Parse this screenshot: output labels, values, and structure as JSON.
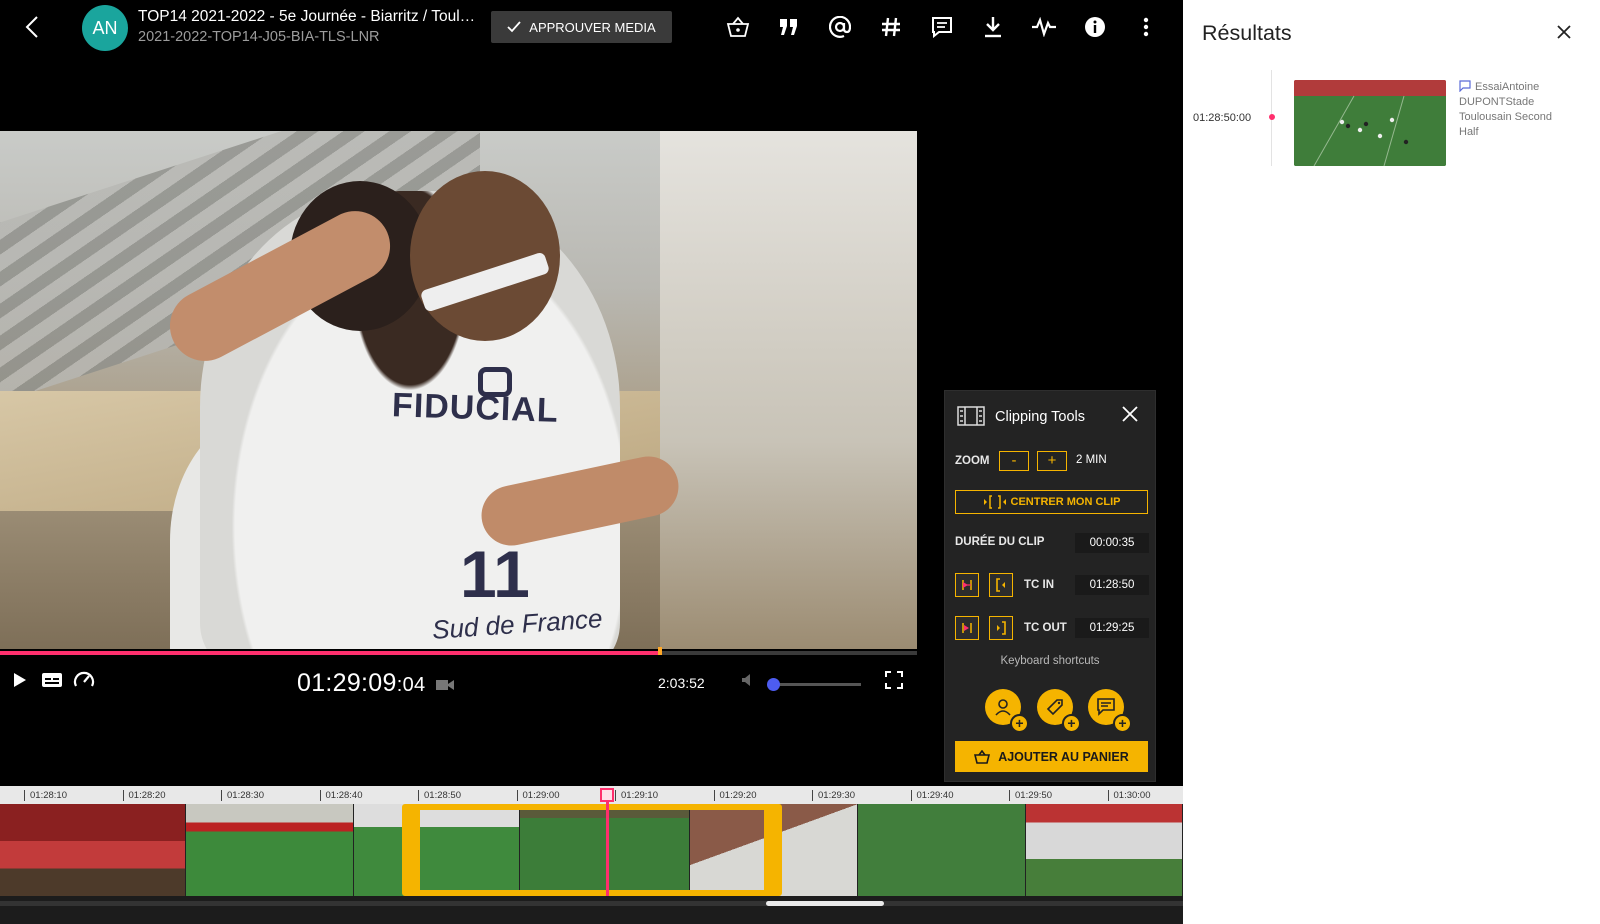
{
  "header": {
    "avatar_initials": "AN",
    "title": "TOP14 2021-2022 - 5e Journée - Biarritz / Toulo...",
    "subtitle": "2021-2022-TOP14-J05-BIA-TLS-LNR",
    "approve_label": "APPROUVER MEDIA",
    "toolbar_icons": [
      "basket-icon",
      "quote-icon",
      "mention-icon",
      "hashtag-icon",
      "comment-icon",
      "download-icon",
      "waveform-icon",
      "info-icon",
      "more-vert-icon"
    ]
  },
  "player": {
    "timecode_main": "01:29:09",
    "timecode_frames": ":04",
    "duration": "2:03:52",
    "progress_fraction": 0.72,
    "volume_fraction": 0.0,
    "video_overlay": {
      "sponsor_text": "FIDUCIAL",
      "jersey_number": "11",
      "sleeve_text": "Sud de France"
    }
  },
  "clipping_tools": {
    "title": "Clipping Tools",
    "zoom_label": "ZOOM",
    "zoom_minus": "-",
    "zoom_plus": "+",
    "zoom_value": "2 MIN",
    "center_label": "CENTRER MON CLIP",
    "duration_label": "DURÉE DU CLIP",
    "duration_value": "00:00:35",
    "tc_in_label": "TC IN",
    "tc_in_value": "01:28:50",
    "tc_out_label": "TC OUT",
    "tc_out_value": "01:29:25",
    "keyboard_shortcuts": "Keyboard shortcuts",
    "add_to_cart": "AJOUTER AU PANIER"
  },
  "timeline": {
    "ticks": [
      "01:28:10",
      "01:28:20",
      "01:28:30",
      "01:28:40",
      "01:28:50",
      "01:29:00",
      "01:29:10",
      "01:29:20",
      "01:29:30",
      "01:29:40",
      "01:29:50",
      "01:30:00"
    ]
  },
  "sidebar": {
    "title": "Résultats",
    "results": [
      {
        "time": "01:28:50:00",
        "description": "EssaiAntoine DUPONTStade Toulousain Second Half"
      }
    ]
  },
  "colors": {
    "accent": "#f5b400",
    "playhead": "#ff2f6d",
    "avatar": "#1aa59d",
    "volume": "#4d5cf0"
  }
}
